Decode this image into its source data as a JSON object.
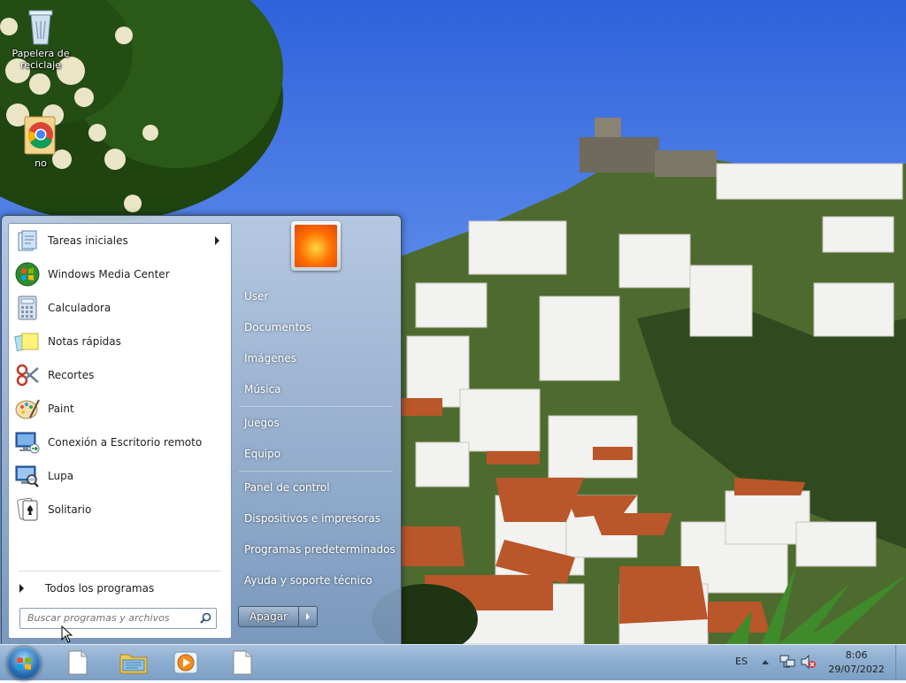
{
  "desktop": {
    "icons": [
      {
        "label": "Papelera de reciclaje",
        "icon": "recycle-bin-icon"
      },
      {
        "label": "no",
        "icon": "chrome-icon"
      }
    ]
  },
  "start_menu": {
    "programs": [
      {
        "label": "Tareas iniciales",
        "icon": "getting-started-icon",
        "has_submenu": true
      },
      {
        "label": "Windows Media Center",
        "icon": "media-center-icon"
      },
      {
        "label": "Calculadora",
        "icon": "calculator-icon"
      },
      {
        "label": "Notas rápidas",
        "icon": "sticky-notes-icon"
      },
      {
        "label": "Recortes",
        "icon": "snipping-tool-icon"
      },
      {
        "label": "Paint",
        "icon": "paint-icon"
      },
      {
        "label": "Conexión a Escritorio remoto",
        "icon": "remote-desktop-icon"
      },
      {
        "label": "Lupa",
        "icon": "magnifier-icon"
      },
      {
        "label": "Solitario",
        "icon": "solitaire-icon"
      }
    ],
    "all_programs_label": "Todos los programas",
    "search_placeholder": "Buscar programas y archivos",
    "right_items": [
      {
        "label": "User"
      },
      {
        "label": "Documentos"
      },
      {
        "label": "Imágenes"
      },
      {
        "label": "Música"
      },
      {
        "label": "Juegos"
      },
      {
        "label": "Equipo"
      },
      {
        "label": "Panel de control"
      },
      {
        "label": "Dispositivos e impresoras"
      },
      {
        "label": "Programas predeterminados"
      },
      {
        "label": "Ayuda y soporte técnico"
      }
    ],
    "shutdown_label": "Apagar"
  },
  "taskbar": {
    "pinned": [
      {
        "icon": "blank-document-icon"
      },
      {
        "icon": "file-explorer-icon"
      },
      {
        "icon": "media-player-icon"
      },
      {
        "icon": "blank-document-icon"
      }
    ],
    "language": "ES",
    "time": "8:06",
    "date": "29/07/2022"
  }
}
